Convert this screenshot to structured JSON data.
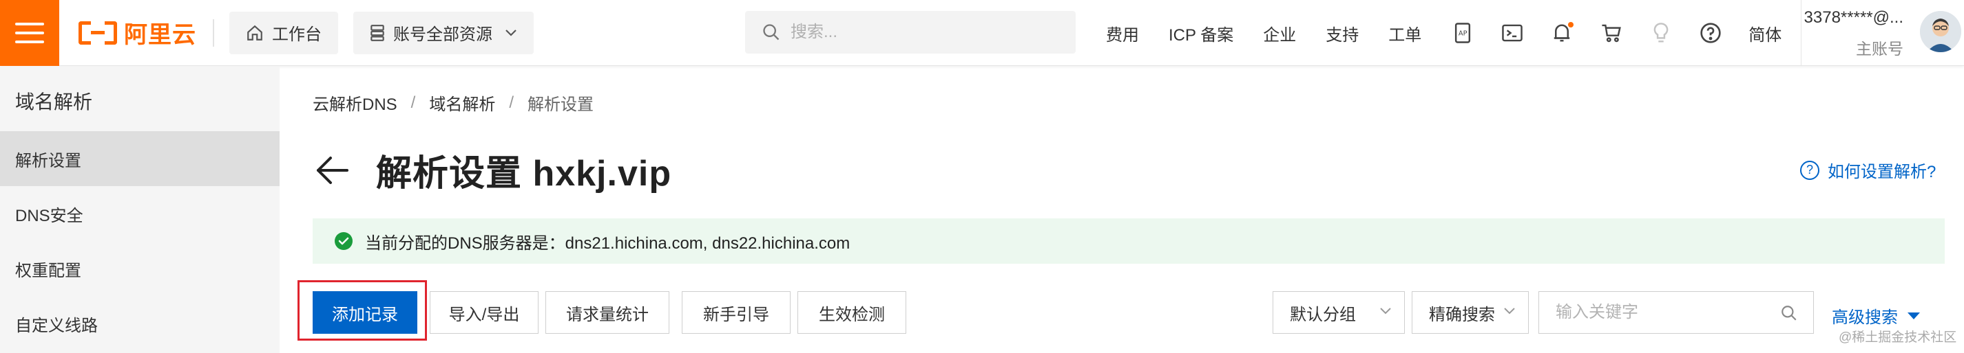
{
  "topbar": {
    "brand": "阿里云",
    "workbench": "工作台",
    "resource_scope": "账号全部资源",
    "search_placeholder": "搜索...",
    "nav": [
      "费用",
      "ICP 备案",
      "企业",
      "支持",
      "工单"
    ],
    "icons": [
      "app-icon",
      "terminal-icon",
      "bell-icon",
      "cart-icon",
      "lightbulb-icon",
      "help-icon"
    ],
    "language": "简体",
    "account_name": "3378*****@...",
    "account_role": "主账号"
  },
  "sidebar": {
    "title": "域名解析",
    "items": [
      "解析设置",
      "DNS安全",
      "权重配置",
      "自定义线路"
    ],
    "active_index": 0
  },
  "breadcrumb": {
    "items": [
      "云解析DNS",
      "域名解析",
      "解析设置"
    ]
  },
  "page": {
    "title": "解析设置 hxkj.vip",
    "help_link": "如何设置解析?",
    "notice": "当前分配的DNS服务器是：dns21.hichina.com, dns22.hichina.com"
  },
  "toolbar": {
    "add_record": "添加记录",
    "import_export": "导入/导出",
    "query_stats": "请求量统计",
    "beginner_guide": "新手引导",
    "effect_check": "生效检测",
    "group_select": "默认分组",
    "search_mode": "精确搜索",
    "keyword_placeholder": "输入关键字",
    "advanced_search": "高级搜索"
  },
  "watermark": "@稀土掘金技术社区",
  "colors": {
    "brand": "#ff6a00",
    "primary": "#0064c8",
    "highlight_frame": "#e0242e",
    "notice_bg": "#ecf8ef",
    "success": "#1a9c3c"
  }
}
